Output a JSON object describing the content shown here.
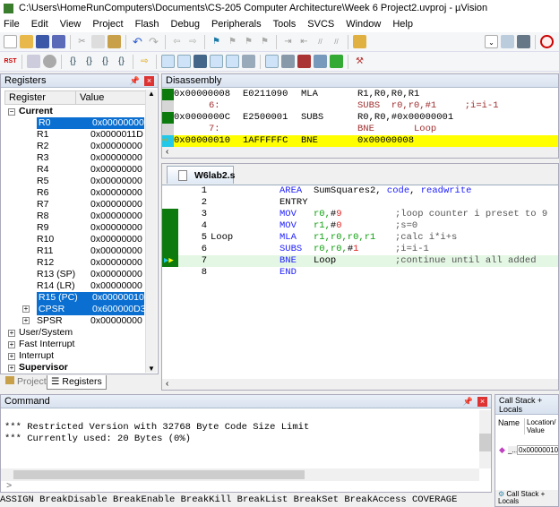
{
  "title": "C:\\Users\\HomeRunComputers\\Documents\\CS-205 Computer Architecture\\Week 6 Project2.uvproj - µVision",
  "menu": [
    "File",
    "Edit",
    "View",
    "Project",
    "Flash",
    "Debug",
    "Peripherals",
    "Tools",
    "SVCS",
    "Window",
    "Help"
  ],
  "registers": {
    "title": "Registers",
    "col_register": "Register",
    "col_value": "Value",
    "group": "Current",
    "rows": [
      {
        "name": "R0",
        "value": "0x00000000"
      },
      {
        "name": "R1",
        "value": "0x0000011D"
      },
      {
        "name": "R2",
        "value": "0x00000000"
      },
      {
        "name": "R3",
        "value": "0x00000000"
      },
      {
        "name": "R4",
        "value": "0x00000000"
      },
      {
        "name": "R5",
        "value": "0x00000000"
      },
      {
        "name": "R6",
        "value": "0x00000000"
      },
      {
        "name": "R7",
        "value": "0x00000000"
      },
      {
        "name": "R8",
        "value": "0x00000000"
      },
      {
        "name": "R9",
        "value": "0x00000000"
      },
      {
        "name": "R10",
        "value": "0x00000000"
      },
      {
        "name": "R11",
        "value": "0x00000000"
      },
      {
        "name": "R12",
        "value": "0x00000000"
      },
      {
        "name": "R13 (SP)",
        "value": "0x00000000"
      },
      {
        "name": "R14 (LR)",
        "value": "0x00000000"
      },
      {
        "name": "R15 (PC)",
        "value": "0x00000010"
      },
      {
        "name": "CPSR",
        "value": "0x600000D3"
      },
      {
        "name": "SPSR",
        "value": "0x00000000"
      }
    ],
    "modes": [
      "User/System",
      "Fast Interrupt",
      "Interrupt",
      "Supervisor"
    ]
  },
  "left_tabs": {
    "project": "Project",
    "registers": "Registers"
  },
  "disassembly": {
    "title": "Disassembly",
    "lines": [
      {
        "addr": "0x00000008",
        "code": "E0211090",
        "mn": "MLA",
        "ops": "R1,R0,R0,R1",
        "src": false
      },
      {
        "line": "6:",
        "text": "SUBS  r0,r0,#1     ;i=i-1",
        "src": true
      },
      {
        "addr": "0x0000000C",
        "code": "E2500001",
        "mn": "SUBS",
        "ops": "R0,R0,#0x00000001",
        "src": false
      },
      {
        "line": "7:",
        "text": "BNE       Loop",
        "src": true
      },
      {
        "addr": "0x00000010",
        "code": "1AFFFFFC",
        "mn": "BNE",
        "ops": "0x00000008",
        "src": false
      }
    ]
  },
  "editor": {
    "tab": "W6lab2.s",
    "lines": [
      {
        "n": "1",
        "label": "",
        "op": "AREA",
        "args": "SumSquares2, code, readwrite",
        "comment": ""
      },
      {
        "n": "2",
        "label": "",
        "op": "ENTRY",
        "args": "",
        "comment": ""
      },
      {
        "n": "3",
        "label": "",
        "op": "MOV",
        "args": "r0,#9",
        "comment": ";loop counter i preset to 9"
      },
      {
        "n": "4",
        "label": "",
        "op": "MOV",
        "args": "r1,#0",
        "comment": ";s=0"
      },
      {
        "n": "5",
        "label": "Loop",
        "op": "MLA",
        "args": "r1,r0,r0,r1",
        "comment": ";calc i*i+s"
      },
      {
        "n": "6",
        "label": "",
        "op": "SUBS",
        "args": "r0,r0,#1",
        "comment": ";i=i-1"
      },
      {
        "n": "7",
        "label": "",
        "op": "BNE",
        "args": "Loop",
        "comment": ";continue until all added"
      },
      {
        "n": "8",
        "label": "",
        "op": "END",
        "args": "",
        "comment": ""
      }
    ]
  },
  "command": {
    "title": "Command",
    "lines": [
      "*** Restricted Version with 32768 Byte Code Size Limit",
      "*** Currently used: 20 Bytes (0%)"
    ],
    "prompt": ">",
    "status": "ASSIGN BreakDisable BreakEnable BreakKill BreakList BreakSet BreakAccess COVERAGE"
  },
  "callstack": {
    "title": "Call Stack + Locals",
    "col_name": "Name",
    "col_location": "Location/Value",
    "row_name": "_...",
    "row_value": "0x00000010",
    "tab": "Call Stack + Locals"
  }
}
